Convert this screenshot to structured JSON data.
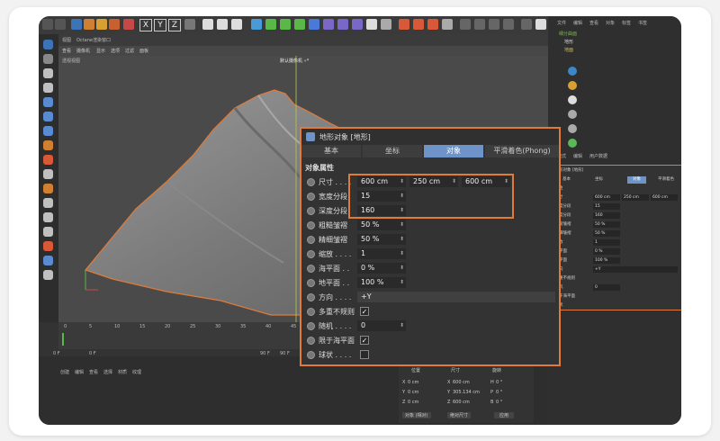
{
  "panel": {
    "title": "地形对象 [地形]",
    "tabs": [
      "基本",
      "坐标",
      "对象",
      "平滑着色(Phong)"
    ],
    "section": "对象属性",
    "rows": {
      "size": {
        "label": "尺寸 . . . .",
        "x": "600 cm",
        "y": "250 cm",
        "z": "600 cm"
      },
      "width_seg": {
        "label": "宽度分段",
        "value": "15"
      },
      "depth_seg": {
        "label": "深度分段",
        "value": "160"
      },
      "rough": {
        "label": "粗糙皱褶",
        "value": "50 %"
      },
      "fine": {
        "label": "精细皱褶",
        "value": "50 %"
      },
      "scale": {
        "label": "缩放 . . . .",
        "value": "1"
      },
      "sea": {
        "label": "海平面 . .",
        "value": "0 %"
      },
      "ground": {
        "label": "地平面 . .",
        "value": "100 %"
      },
      "direction": {
        "label": "方向 . . . .",
        "value": "+Y"
      },
      "multi": {
        "label": "多重不规则"
      },
      "random": {
        "label": "随机 . . . .",
        "value": "0"
      },
      "limit": {
        "label": "限于海平面"
      },
      "sphere": {
        "label": "球状 . . . ."
      }
    }
  },
  "viewport": {
    "menu": [
      "视图",
      "Octane渲染窗口"
    ],
    "menu2": [
      "查看",
      "摄像机",
      "显示",
      "选项",
      "过滤",
      "面板"
    ],
    "label": "透视视图",
    "camera": "默认摄像机 ∘*",
    "ruler": [
      "0",
      "5",
      "10",
      "15",
      "20",
      "25",
      "30",
      "35",
      "40",
      "45",
      "50",
      "55",
      "60",
      "65",
      "70",
      "75",
      "80",
      "85",
      "90"
    ]
  },
  "timeline": {
    "start": "0 F",
    "cur": "0 F",
    "end": "90 F",
    "end2": "90 F"
  },
  "bottom_menu": [
    "创建",
    "编辑",
    "查看",
    "选择",
    "材质",
    "纹理"
  ],
  "coords": {
    "headers": [
      "位置",
      "尺寸",
      "旋转"
    ],
    "rows": [
      [
        "X",
        "0 cm",
        "X",
        "600 cm",
        "H",
        "0 °"
      ],
      [
        "Y",
        "0 cm",
        "Y",
        "305.134 cm",
        "P",
        "0 °"
      ],
      [
        "Z",
        "0 cm",
        "Z",
        "600 cm",
        "B",
        "0 °"
      ]
    ],
    "mode1": "对象 (相对)",
    "mode2": "绝对尺寸",
    "apply": "应用"
  },
  "right": {
    "menu": [
      "文件",
      "编辑",
      "查看",
      "对象",
      "标签",
      "书签"
    ],
    "objects": [
      "细分曲面",
      "地形",
      "地面"
    ],
    "attr_menu": [
      "模式",
      "编辑",
      "用户数据"
    ],
    "attr_title": "形对象 [地形]",
    "attr_tabs": [
      "基本",
      "坐标",
      "对象",
      "平滑着色"
    ],
    "attr_section": "性",
    "attr_rows": [
      [
        "寸",
        "600 cm",
        "250 cm",
        "600 cm"
      ],
      [
        "度分段",
        "15"
      ],
      [
        "度分段",
        "160"
      ],
      [
        "糙皱褶",
        "50 %"
      ],
      [
        "细皱褶",
        "50 %"
      ],
      [
        "放",
        "1"
      ],
      [
        "平面",
        "0 %"
      ],
      [
        "平面",
        "100 %"
      ],
      [
        "向",
        "+Y"
      ],
      [
        "重不规则",
        ""
      ],
      [
        "机",
        "0"
      ],
      [
        "于海平面",
        ""
      ],
      [
        "状",
        ""
      ]
    ]
  },
  "colors": {
    "accent": "#e07b39",
    "tab_active": "#6d93c8"
  }
}
